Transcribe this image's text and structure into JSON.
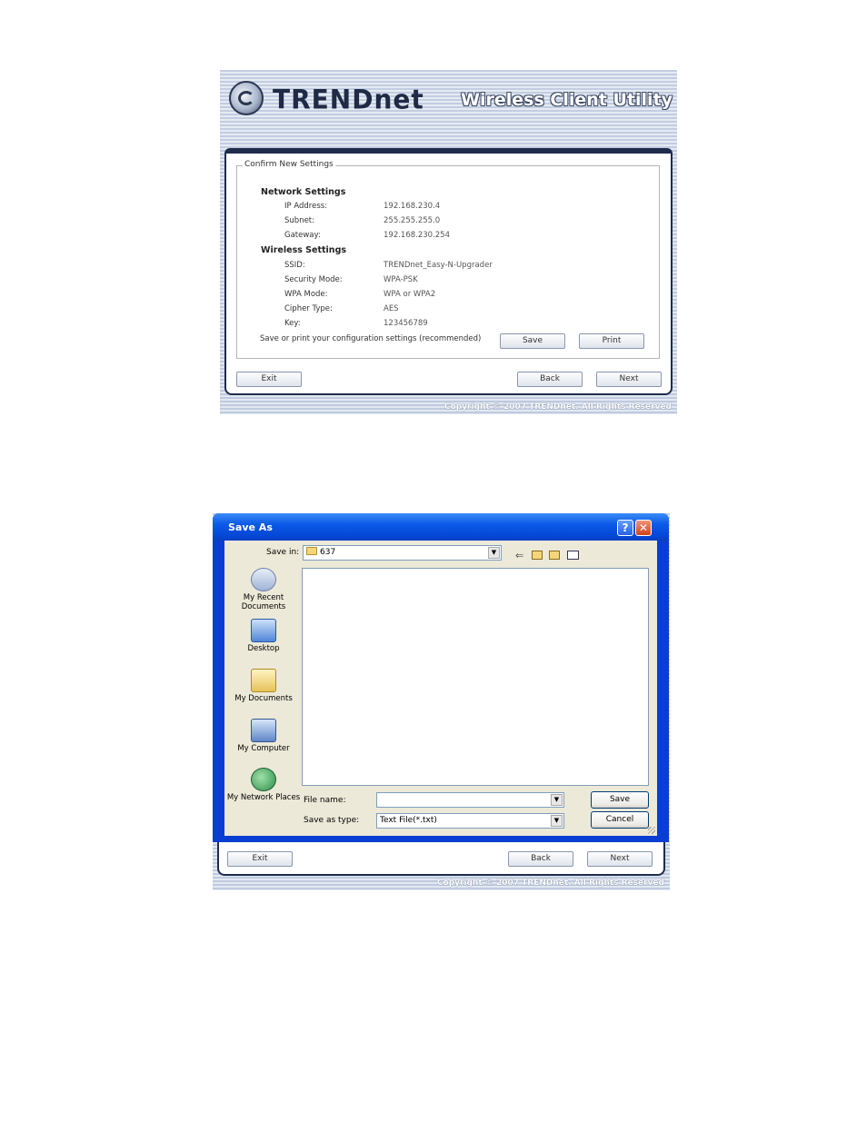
{
  "confirm_window": {
    "brand": "TRENDnet",
    "app_title": "Wireless Client Utility",
    "group_title": "Confirm New Settings",
    "network_header": "Network Settings",
    "network": [
      {
        "label": "IP Address:",
        "value": "192.168.230.4"
      },
      {
        "label": "Subnet:",
        "value": "255.255.255.0"
      },
      {
        "label": "Gateway:",
        "value": "192.168.230.254"
      }
    ],
    "wireless_header": "Wireless Settings",
    "wireless": [
      {
        "label": "SSID:",
        "value": "TRENDnet_Easy-N-Upgrader"
      },
      {
        "label": "Security Mode:",
        "value": "WPA-PSK"
      },
      {
        "label": "WPA Mode:",
        "value": "WPA or WPA2"
      },
      {
        "label": "Cipher Type:",
        "value": "AES"
      },
      {
        "label": "Key:",
        "value": "123456789"
      }
    ],
    "save_note": "Save or print your configuration settings (recommended)",
    "save_label": "Save",
    "print_label": "Print",
    "exit_label": "Exit",
    "back_label": "Back",
    "next_label": "Next",
    "copyright": "Copyright © 2007 TRENDnet. All Rights Reserved"
  },
  "save_as": {
    "title": "Save As",
    "help_glyph": "?",
    "close_glyph": "✕",
    "save_in_label": "Save in:",
    "save_in_value": "637",
    "places": [
      "My Recent Documents",
      "Desktop",
      "My Documents",
      "My Computer",
      "My Network Places"
    ],
    "file_name_label": "File name:",
    "file_name_value": "",
    "save_as_type_label": "Save as type:",
    "save_as_type_value": "Text File(*.txt)",
    "save_label": "Save",
    "cancel_label": "Cancel"
  },
  "background_window": {
    "exit_label": "Exit",
    "back_label": "Back",
    "next_label": "Next",
    "copyright": "Copyright © 2007 TRENDnet. All Rights Reserved"
  },
  "colors": {
    "xp_title_blue": "#0b5ae6",
    "panel_navy": "#1f2c4c",
    "dialog_face": "#ece9d8"
  }
}
